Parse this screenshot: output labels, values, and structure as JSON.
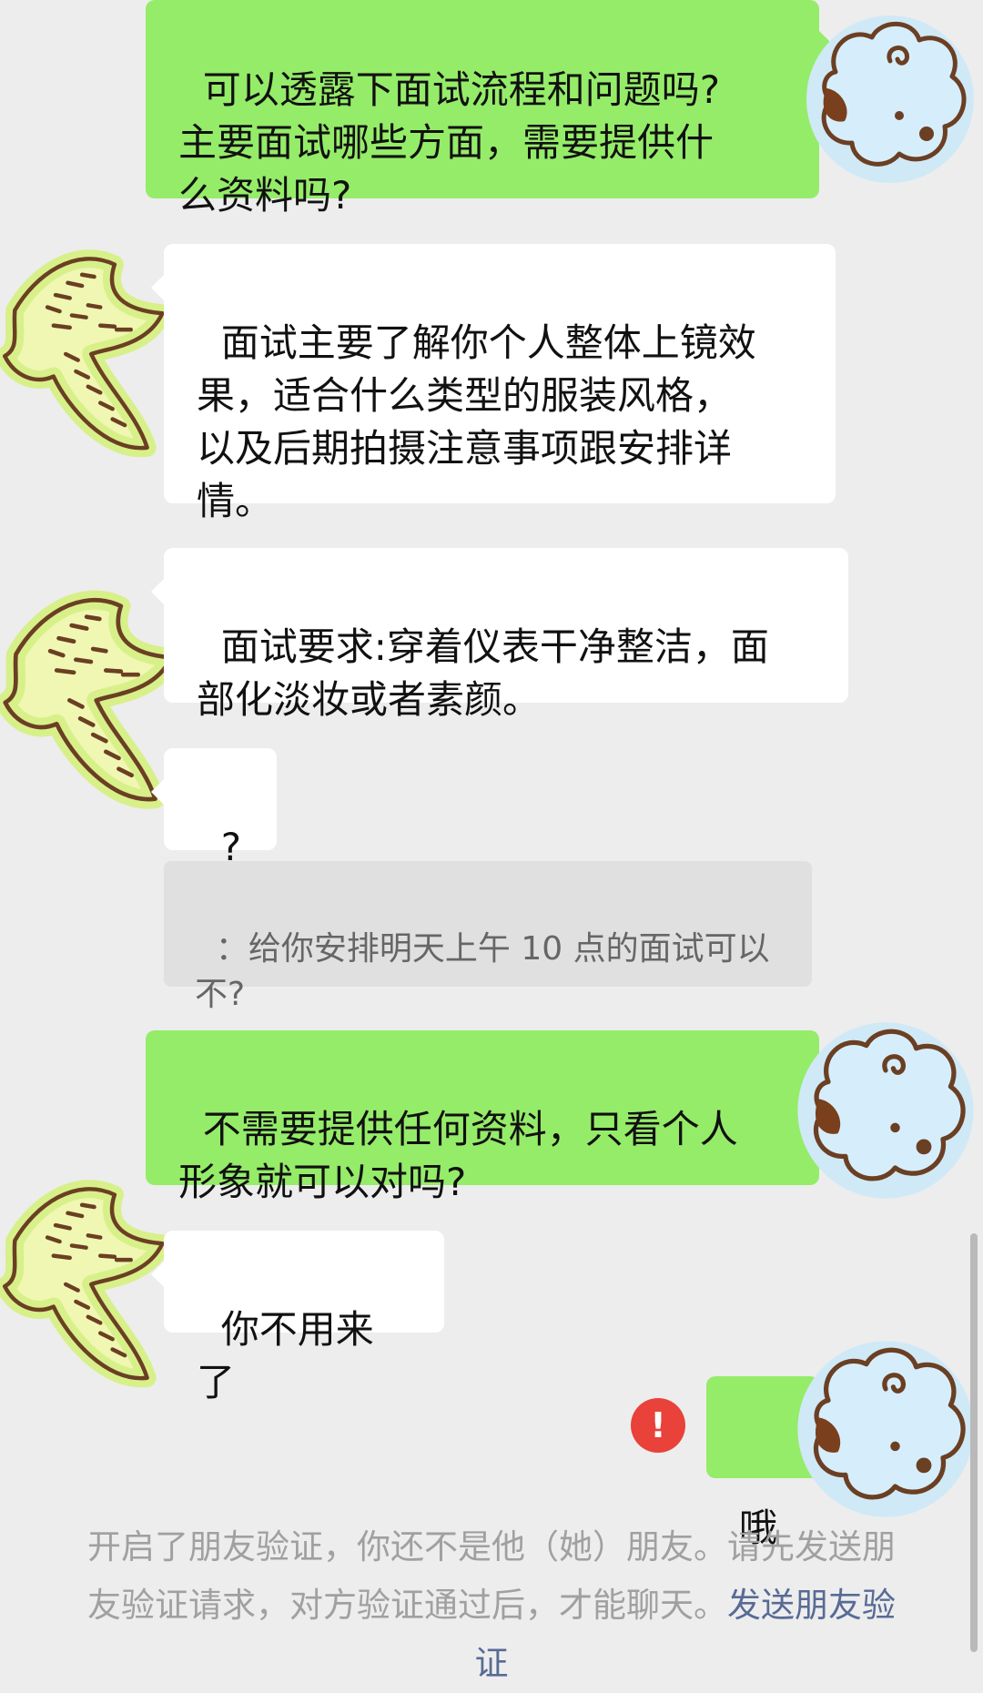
{
  "messages": [
    {
      "id": "m1",
      "side": "out",
      "text": "可以透露下面试流程和问题吗?\n主要面试哪些方面，需要提供什\n么资料吗?"
    },
    {
      "id": "m2",
      "side": "in",
      "text": "面试主要了解你个人整体上镜效\n果，适合什么类型的服装风格，\n以及后期拍摄注意事项跟安排详\n情。"
    },
    {
      "id": "m3",
      "side": "in",
      "text": "面试要求:穿着仪表干净整洁，面\n部化淡妆或者素颜。"
    },
    {
      "id": "m4",
      "side": "in",
      "text": "?"
    },
    {
      "id": "m4q",
      "side": "quote",
      "text": "：给你安排明天上午 10 点的面试可以\n不?"
    },
    {
      "id": "m5",
      "side": "out",
      "text": "不需要提供任何资料，只看个人\n形象就可以对吗?"
    },
    {
      "id": "m6",
      "side": "in",
      "text": "你不用来了"
    },
    {
      "id": "m7",
      "side": "out",
      "text": "哦",
      "status": "failed"
    }
  ],
  "error_icon": "!",
  "system_notice": {
    "text": "开启了朋友验证，你还不是他（她）朋友。请先发送朋友验证请求，对方验证通过后，才能聊天。",
    "link_text": "发送朋友验证"
  },
  "colors": {
    "background": "#ededed",
    "outgoing_bubble": "#95ec69",
    "incoming_bubble": "#ffffff",
    "quote_background": "#e0e0e0",
    "error": "#e8423a",
    "link": "#576b95"
  },
  "icons": {
    "contact_avatar": "bird-drawing-icon",
    "self_avatar": "sheep-drawing-icon",
    "error": "exclamation-circle-icon"
  }
}
